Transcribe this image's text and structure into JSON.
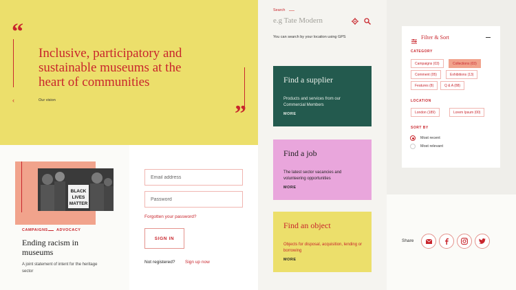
{
  "vision": {
    "heading": "Inclusive, participatory and sustainable museums at the heart of communities",
    "subtitle": "Our vision"
  },
  "article": {
    "tag1": "CAMPAIGNS",
    "tag2": "ADVOCACY",
    "title": "Ending racism in museums",
    "description": "A joint statement of intent for the heritage sector",
    "photo_sign": "BLACK LIVES MATTER"
  },
  "signin": {
    "email_placeholder": "Email address",
    "password_placeholder": "Password",
    "forgot": "Forgotten your password?",
    "button": "SIGN IN",
    "not_registered": "Not registered?",
    "signup": "Sign up now"
  },
  "search": {
    "label": "Search",
    "placeholder": "e.g Tate Modern",
    "hint": "You can search by your location using GPS"
  },
  "cards": [
    {
      "title": "Find a supplier",
      "text": "Products and services from our Commercial  Members",
      "more": "MORE"
    },
    {
      "title": "Find a job",
      "text": "The latest sector vacancies and volunteering opportunities",
      "more": "MORE"
    },
    {
      "title": "Find an object",
      "text": "Objects for disposal, acquisition, lending or borrowing",
      "more": "MORE"
    }
  ],
  "filter": {
    "title": "Filter & Sort",
    "category_label": "CATEGORY",
    "categories": [
      {
        "label": "Campaigns (03)",
        "active": false
      },
      {
        "label": "Collections (03)",
        "active": true
      },
      {
        "label": "Comment (05)",
        "active": false
      },
      {
        "label": "Exhibitions (13)",
        "active": false
      },
      {
        "label": "Features (8)",
        "active": false
      },
      {
        "label": "Q & A (88)",
        "active": false
      }
    ],
    "location_label": "LOCATION",
    "locations": [
      "London (189)",
      "Lorem Ipsum (00)"
    ],
    "sort_label": "SORT BY",
    "sort_options": [
      {
        "label": "Most recent",
        "checked": true
      },
      {
        "label": "Most relevant",
        "checked": false
      }
    ]
  },
  "share": {
    "label": "Share",
    "icons": [
      "mail-icon",
      "facebook-icon",
      "instagram-icon",
      "twitter-icon"
    ]
  },
  "colors": {
    "accent": "#c8252c",
    "yellow": "#ecdf6b",
    "green": "#235a4e",
    "pink": "#e9a6dc",
    "peach": "#f1a38c"
  }
}
